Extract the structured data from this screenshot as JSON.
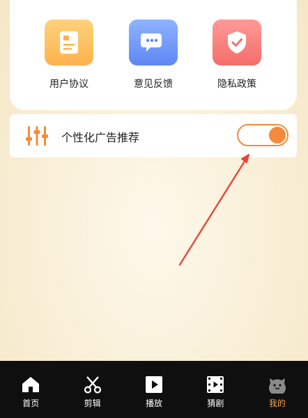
{
  "menu": {
    "items": [
      {
        "label": "用户协议",
        "icon": "document-icon"
      },
      {
        "label": "意见反馈",
        "icon": "chat-icon"
      },
      {
        "label": "隐私政策",
        "icon": "shield-icon"
      }
    ]
  },
  "settings": {
    "personalized_ads": {
      "label": "个性化广告推荐",
      "enabled": true
    }
  },
  "tabbar": {
    "items": [
      {
        "label": "首页",
        "icon": "home-icon"
      },
      {
        "label": "剪辑",
        "icon": "scissors-icon"
      },
      {
        "label": "播放",
        "icon": "play-icon"
      },
      {
        "label": "猜剧",
        "icon": "film-icon"
      },
      {
        "label": "我的",
        "icon": "profile-icon",
        "active": true
      }
    ]
  },
  "colors": {
    "accent": "#f58a3c",
    "active_tab": "#f5a04a",
    "annotation_arrow": "#e8463a"
  }
}
